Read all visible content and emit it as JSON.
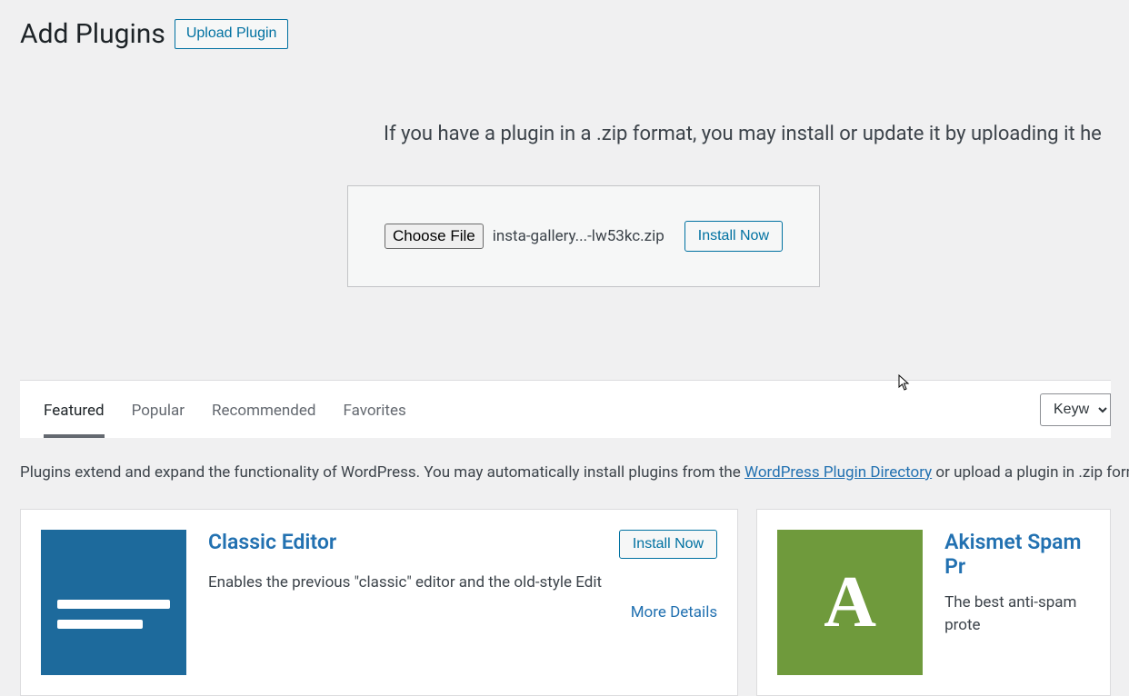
{
  "header": {
    "title": "Add Plugins",
    "upload_button": "Upload Plugin"
  },
  "upload": {
    "help_text": "If you have a plugin in a .zip format, you may install or update it by uploading it he",
    "choose_file_label": "Choose File",
    "file_name": "insta-gallery...-lw53kc.zip",
    "install_now": "Install Now"
  },
  "tabs": {
    "items": [
      {
        "label": "Featured",
        "active": true
      },
      {
        "label": "Popular",
        "active": false
      },
      {
        "label": "Recommended",
        "active": false
      },
      {
        "label": "Favorites",
        "active": false
      }
    ],
    "search_filter": "Keyw"
  },
  "intro": {
    "prefix": "Plugins extend and expand the functionality of WordPress. You may automatically install plugins from the ",
    "link": "WordPress Plugin Directory",
    "suffix": " or upload a plugin in .zip format by c"
  },
  "cards": [
    {
      "title": "Classic Editor",
      "desc": "Enables the previous \"classic\" editor and the old-style Edit",
      "install": "Install Now",
      "more": "More Details"
    },
    {
      "title": "Akismet Spam Pr",
      "desc": "The best anti-spam prote"
    }
  ]
}
